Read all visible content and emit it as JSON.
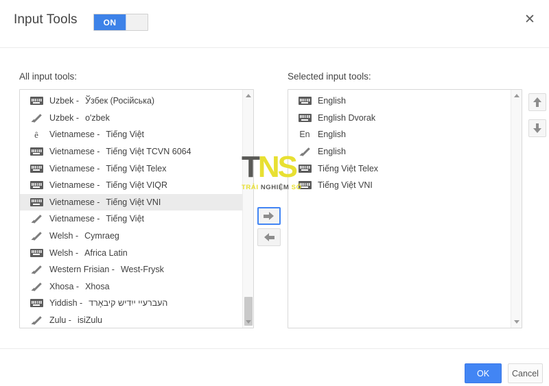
{
  "dialog": {
    "title": "Input Tools",
    "toggle_label": "ON",
    "close_icon": "close-icon"
  },
  "panels": {
    "all_label": "All input tools:",
    "selected_label": "Selected input tools:"
  },
  "all_input_tools": [
    {
      "icon": "keyboard-icon",
      "glyph": "",
      "lang": "Uzbek -",
      "native": "Ўзбек (Російська)",
      "rtl": false,
      "selected": false
    },
    {
      "icon": "pencil-icon",
      "glyph": "",
      "lang": "Uzbek -",
      "native": "o'zbek",
      "rtl": false,
      "selected": false
    },
    {
      "icon": "text-glyph-icon",
      "glyph": "ê",
      "lang": "Vietnamese -",
      "native": "Tiếng Việt",
      "rtl": false,
      "selected": false
    },
    {
      "icon": "keyboard-icon",
      "glyph": "",
      "lang": "Vietnamese -",
      "native": "Tiếng Việt TCVN 6064",
      "rtl": false,
      "selected": false
    },
    {
      "icon": "keyboard-icon",
      "glyph": "",
      "lang": "Vietnamese -",
      "native": "Tiếng Việt Telex",
      "rtl": false,
      "selected": false
    },
    {
      "icon": "keyboard-icon",
      "glyph": "",
      "lang": "Vietnamese -",
      "native": "Tiếng Việt VIQR",
      "rtl": false,
      "selected": false
    },
    {
      "icon": "keyboard-icon",
      "glyph": "",
      "lang": "Vietnamese -",
      "native": "Tiếng Việt VNI",
      "rtl": false,
      "selected": true
    },
    {
      "icon": "pencil-icon",
      "glyph": "",
      "lang": "Vietnamese -",
      "native": "Tiếng Việt",
      "rtl": false,
      "selected": false
    },
    {
      "icon": "pencil-icon",
      "glyph": "",
      "lang": "Welsh -",
      "native": "Cymraeg",
      "rtl": false,
      "selected": false
    },
    {
      "icon": "keyboard-icon",
      "glyph": "",
      "lang": "Welsh -",
      "native": "Africa Latin",
      "rtl": false,
      "selected": false
    },
    {
      "icon": "pencil-icon",
      "glyph": "",
      "lang": "Western Frisian -",
      "native": "West-Frysk",
      "rtl": false,
      "selected": false
    },
    {
      "icon": "pencil-icon",
      "glyph": "",
      "lang": "Xhosa -",
      "native": "Xhosa",
      "rtl": false,
      "selected": false
    },
    {
      "icon": "keyboard-icon",
      "glyph": "",
      "lang": "Yiddish -",
      "native": "העברעיי ייִדיש קיבאָרד",
      "rtl": true,
      "selected": false
    },
    {
      "icon": "pencil-icon",
      "glyph": "",
      "lang": "Zulu -",
      "native": "isiZulu",
      "rtl": false,
      "selected": false
    }
  ],
  "selected_input_tools": [
    {
      "icon": "keyboard-icon",
      "glyph": "",
      "lang": "English",
      "native": "",
      "rtl": false,
      "selected": false
    },
    {
      "icon": "keyboard-icon",
      "glyph": "",
      "lang": "English Dvorak",
      "native": "",
      "rtl": false,
      "selected": false
    },
    {
      "icon": "text-glyph-icon",
      "glyph": "En",
      "lang": "English",
      "native": "",
      "rtl": false,
      "selected": false
    },
    {
      "icon": "pencil-icon",
      "glyph": "",
      "lang": "English",
      "native": "",
      "rtl": false,
      "selected": false
    },
    {
      "icon": "keyboard-icon",
      "glyph": "",
      "lang": "Tiếng Việt Telex",
      "native": "",
      "rtl": false,
      "selected": false
    },
    {
      "icon": "keyboard-icon",
      "glyph": "",
      "lang": "Tiếng Việt VNI",
      "native": "",
      "rtl": false,
      "selected": false
    }
  ],
  "transfer": {
    "add_icon": "arrow-right-icon",
    "remove_icon": "arrow-left-icon"
  },
  "reorder": {
    "up_icon": "arrow-up-icon",
    "down_icon": "arrow-down-icon"
  },
  "watermark": {
    "letter_1": "T",
    "letter_2": "N",
    "letter_3": "S",
    "tag_part_1": "TRẢI ",
    "tag_part_2": "NGHIỆM",
    "tag_part_3": " SỐ"
  },
  "footer": {
    "ok_label": "OK",
    "cancel_label": "Cancel"
  },
  "colors": {
    "accent_blue": "#4285f4",
    "toggle_on": "#3d82e8",
    "selection_gray": "#ebebeb",
    "watermark_yellow": "#e8e032",
    "watermark_dark": "#5a5a57"
  }
}
